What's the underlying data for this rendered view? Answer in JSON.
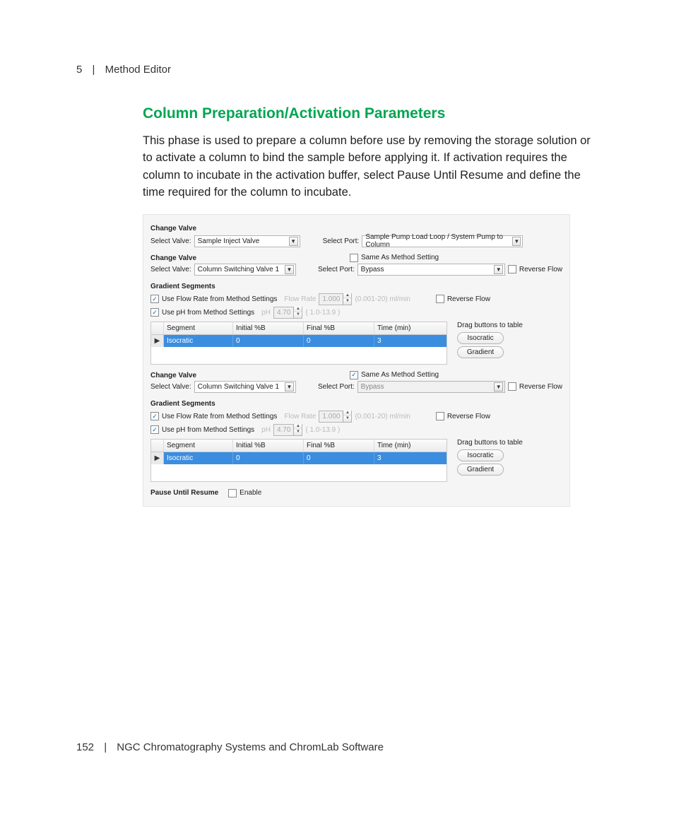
{
  "header": {
    "chapter": "5",
    "title": "Method Editor"
  },
  "section": {
    "title": "Column Preparation/Activation Parameters"
  },
  "paragraph": "This phase is used to prepare a column before use by removing the storage solution or to activate a column to bind the sample before applying it. If activation requires the column to incubate in the activation buffer, select Pause Until Resume and define the time required for the column to incubate.",
  "shot": {
    "valve1": {
      "title": "Change Valve",
      "select_valve_label": "Select Valve:",
      "select_valve_value": "Sample Inject Valve",
      "select_port_label": "Select Port:",
      "select_port_value": "Sample Pump Load Loop / System Pump to Column"
    },
    "valve2": {
      "title": "Change Valve",
      "same_as_label": "Same As Method Setting",
      "select_valve_label": "Select Valve:",
      "select_valve_value": "Column Switching Valve 1",
      "select_port_label": "Select Port:",
      "select_port_value": "Bypass",
      "reverse_flow_label": "Reverse Flow"
    },
    "grad1": {
      "title": "Gradient Segments",
      "use_flow_label": "Use Flow Rate from Method Settings",
      "flow_rate_label": "Flow Rate",
      "flow_rate_value": "1.000",
      "flow_rate_unit": "(0.001-20) ml/min",
      "reverse_flow_label": "Reverse Flow",
      "use_ph_label": "Use pH from Method Settings",
      "ph_label": "pH",
      "ph_value": "4.70",
      "ph_range": "( 1.0-13.9 )",
      "table": {
        "headers": {
          "segment": "Segment",
          "initial_b": "Initial %B",
          "final_b": "Final %B",
          "time": "Time (min)"
        },
        "row": {
          "segment": "Isocratic",
          "initial_b": "0",
          "final_b": "0",
          "time": "3"
        }
      },
      "drag_hint": "Drag buttons to table",
      "btn_iso": "Isocratic",
      "btn_grad": "Gradient"
    },
    "valve3": {
      "title": "Change Valve",
      "same_as_label": "Same As Method Setting",
      "select_valve_label": "Select Valve:",
      "select_valve_value": "Column Switching Valve 1",
      "select_port_label": "Select Port:",
      "select_port_value": "Bypass",
      "reverse_flow_label": "Reverse Flow"
    },
    "grad2": {
      "title": "Gradient Segments",
      "use_flow_label": "Use Flow Rate from Method Settings",
      "flow_rate_label": "Flow Rate",
      "flow_rate_value": "1.000",
      "flow_rate_unit": "(0.001-20) ml/min",
      "reverse_flow_label": "Reverse Flow",
      "use_ph_label": "Use pH from Method Settings",
      "ph_label": "pH",
      "ph_value": "4.70",
      "ph_range": "( 1.0-13.9 )",
      "table": {
        "headers": {
          "segment": "Segment",
          "initial_b": "Initial %B",
          "final_b": "Final %B",
          "time": "Time (min)"
        },
        "row": {
          "segment": "Isocratic",
          "initial_b": "0",
          "final_b": "0",
          "time": "3"
        }
      },
      "drag_hint": "Drag buttons to table",
      "btn_iso": "Isocratic",
      "btn_grad": "Gradient"
    },
    "pause": {
      "title": "Pause Until Resume",
      "enable_label": "Enable"
    }
  },
  "footer": {
    "page": "152",
    "text": "NGC Chromatography Systems and ChromLab Software"
  }
}
